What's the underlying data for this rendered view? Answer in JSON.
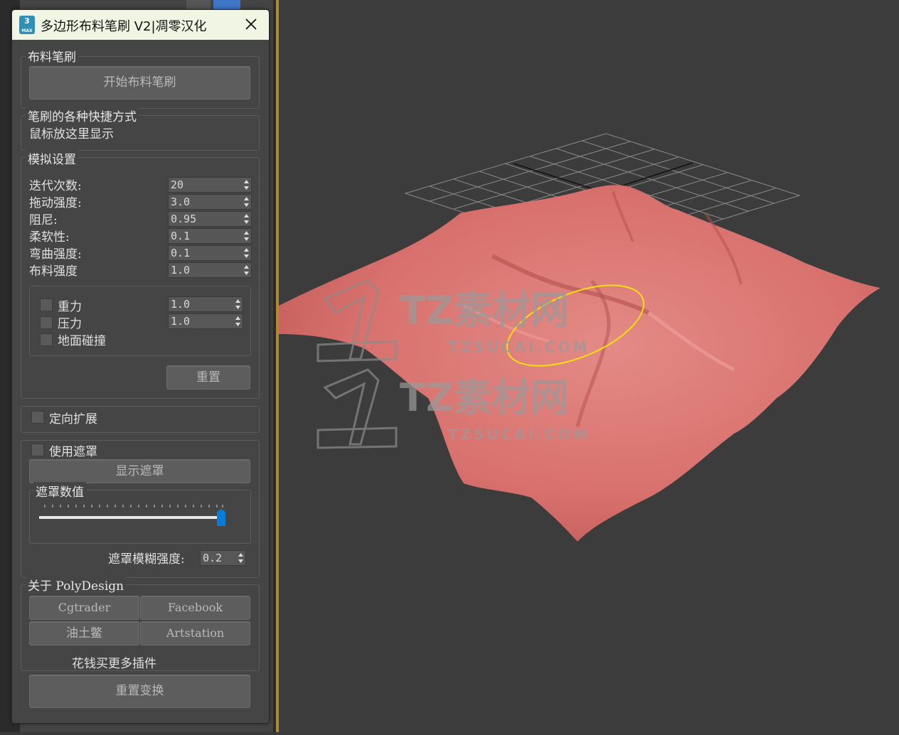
{
  "window": {
    "title": "多边形布料笔刷 V2|凋零汉化",
    "icon_text": "3",
    "icon_sub": "MAX"
  },
  "cloth_brush": {
    "group": "布料笔刷",
    "start_button": "开始布料笔刷"
  },
  "shortcuts": {
    "group": "笔刷的各种快捷方式",
    "hint": "鼠标放这里显示"
  },
  "simulation": {
    "group": "模拟设置",
    "params": [
      {
        "label": "迭代次数:",
        "value": "20"
      },
      {
        "label": "拖动强度:",
        "value": "3.0"
      },
      {
        "label": "阻尼:",
        "value": "0.95"
      },
      {
        "label": "柔软性:",
        "value": "0.1"
      },
      {
        "label": "弯曲强度:",
        "value": "0.1"
      },
      {
        "label": "布料强度",
        "value": "1.0"
      }
    ],
    "forces": [
      {
        "label": "重力",
        "value": "1.0"
      },
      {
        "label": "压力",
        "value": "1.0"
      },
      {
        "label": "地面碰撞"
      }
    ],
    "reset_button": "重置"
  },
  "directional": {
    "label": "定向扩展"
  },
  "mask": {
    "use_label": "使用遮罩",
    "show_button": "显示遮罩",
    "value_group": "遮罩数值",
    "slider_value": 1.0,
    "blur_label": "遮罩模糊强度:",
    "blur_value": "0.2"
  },
  "about": {
    "group": "关于 PolyDesign",
    "buttons": [
      "Cgtrader",
      "Facebook",
      "油土鳖",
      "Artstation"
    ],
    "buy_text": "花钱买更多插件",
    "reset_xform_button": "重置变换"
  },
  "watermark": {
    "brand": "TZ素材网",
    "site": "TZSUCAI.COM"
  },
  "colors": {
    "cloth": "#d9716d",
    "accent": "#0a7bd6",
    "brush_ring": "#f1e00a",
    "grid": "#8a8a8a"
  }
}
